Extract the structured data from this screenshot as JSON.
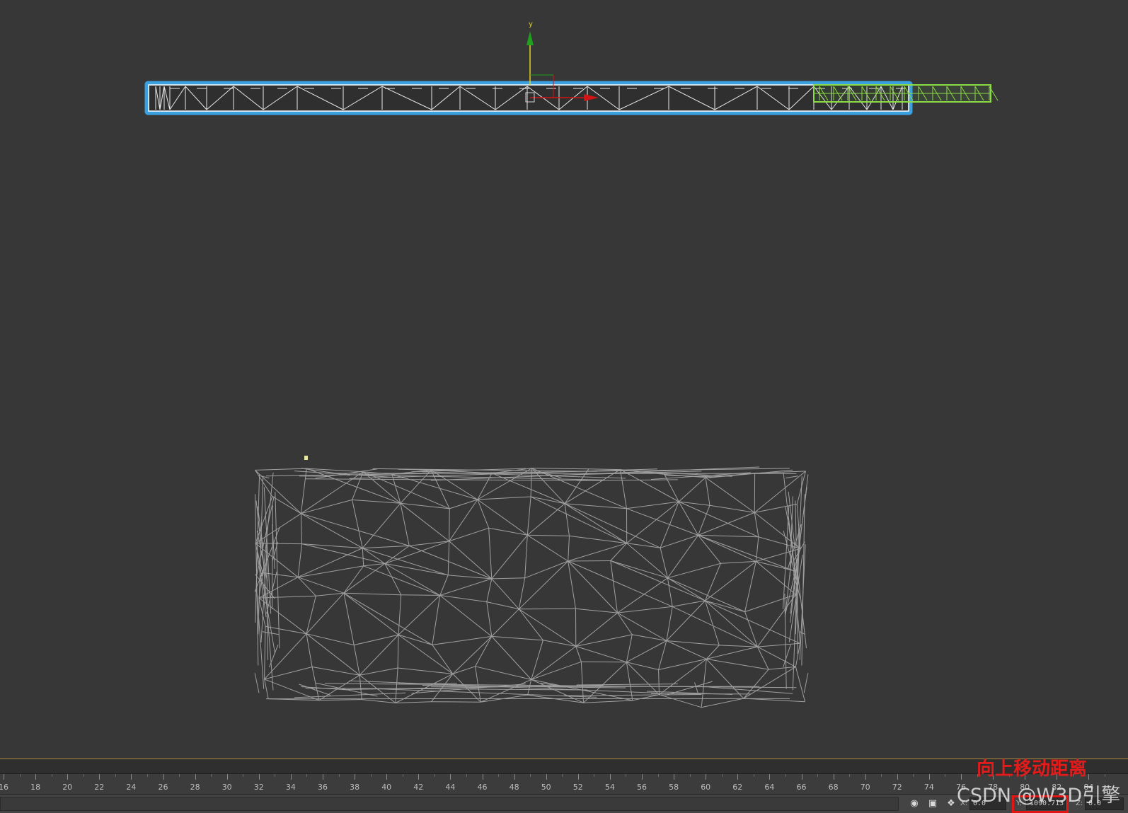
{
  "viewport": {
    "gizmo_axis_label": "y",
    "colors": {
      "background": "#373737",
      "selection_highlight": "#4aa8e0",
      "green_object": "#7fd13b",
      "mesh_wire": "#9a9a9a",
      "gizmo_y": "#1fa01f",
      "gizmo_x": "#d41414"
    }
  },
  "timeline": {
    "frame_labels": [
      "16",
      "18",
      "20",
      "22",
      "24",
      "26",
      "28",
      "30",
      "32",
      "34",
      "36",
      "38",
      "40",
      "42",
      "44",
      "46",
      "48",
      "50",
      "52",
      "54",
      "56",
      "58",
      "60",
      "62",
      "64",
      "66",
      "68",
      "70",
      "72",
      "74",
      "76",
      "78",
      "80",
      "82",
      "84"
    ]
  },
  "statusbar": {
    "icons": [
      "pin-icon",
      "lock-icon",
      "selection-mode-icon"
    ],
    "x_label": "X:",
    "x_value": "0.0",
    "y_label": "Y:",
    "y_value": "1090.713",
    "z_label": "Z:",
    "z_value": "0.0"
  },
  "annotation": {
    "text": "向上移动距离",
    "color": "#e21b1b"
  },
  "watermark": {
    "text": "CSDN @W3D引擎"
  }
}
